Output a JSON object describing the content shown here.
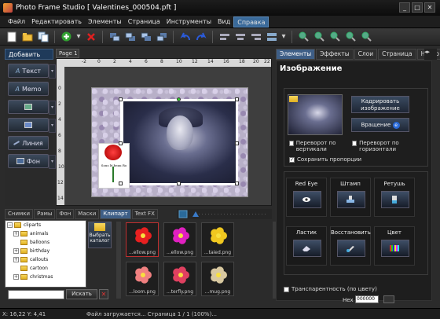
{
  "window": {
    "title": "Photo Frame Studio [ Valentines_000504.pft ]",
    "minimize": "_",
    "maximize": "□",
    "close": "✕"
  },
  "menu": [
    "Файл",
    "Редактировать",
    "Элементы",
    "Страница",
    "Инструменты",
    "Вид",
    "Справка"
  ],
  "left_panel": {
    "header": "Добавить",
    "buttons": [
      "Текст",
      "Memo",
      "",
      "",
      "Линия",
      "Фон"
    ]
  },
  "canvas": {
    "page_tab": "Page 1",
    "ruler_h": [
      "-2",
      "0",
      "2",
      "4",
      "6",
      "8",
      "10",
      "12",
      "14",
      "16",
      "18",
      "20",
      "22"
    ],
    "ruler_v": [
      "0",
      "2",
      "4",
      "6",
      "8",
      "10",
      "12",
      "14"
    ],
    "rose_text": "Sous lé beau Ro"
  },
  "library": {
    "tabs": [
      "Снимки",
      "Рамы",
      "Фон",
      "Маски",
      "Клипарт",
      "Text FX"
    ],
    "active_tab": "Клипарт",
    "tree": [
      {
        "label": "cliparts",
        "expander": "−"
      },
      {
        "label": "animals",
        "expander": "+"
      },
      {
        "label": "balloons",
        "expander": ""
      },
      {
        "label": "birthday",
        "expander": "+"
      },
      {
        "label": "callouts",
        "expander": "+"
      },
      {
        "label": "cartoon",
        "expander": ""
      },
      {
        "label": "christmas",
        "expander": "+"
      }
    ],
    "choose_button": "Выбрать каталог",
    "clips": [
      {
        "caption": "...ellow.png",
        "color": "#e82020",
        "selected": true
      },
      {
        "caption": "...ellow.png",
        "color": "#e020c0",
        "selected": false
      },
      {
        "caption": "...taied.png",
        "color": "#f0c820",
        "selected": false
      },
      {
        "caption": "...loom.png",
        "color": "#f08080",
        "selected": false
      },
      {
        "caption": "...terfly.png",
        "color": "#e04060",
        "selected": false
      },
      {
        "caption": "...mug.png",
        "color": "#d8c8a0",
        "selected": false
      }
    ],
    "search_button": "Искать",
    "search_clear": "✕"
  },
  "right_panel": {
    "tabs": [
      "Элементы",
      "Эффекты",
      "Слои",
      "Страница",
      "Настр"
    ],
    "active_tab": "Элементы",
    "title": "Изображение",
    "crop_button": "Кадрировать изображение",
    "rotate_button": "Вращение",
    "flip_vertical": "Переворот по вертикали",
    "flip_horizontal": "Переворот по горизонтали",
    "keep_proportions": "Сохранить пропорции",
    "tools": [
      "Red Eye",
      "Штамп",
      "Ретушь",
      "Ластик",
      "Восстановить",
      "Цвет"
    ],
    "transparency": "Транспарентность (по цвету)",
    "hex_label": "Hex",
    "hex_value": "000000"
  },
  "status": {
    "coords": "X: 16,22 Y: 4,41",
    "message": "Файл загружается... Страница 1 / 1 (100%)..."
  }
}
